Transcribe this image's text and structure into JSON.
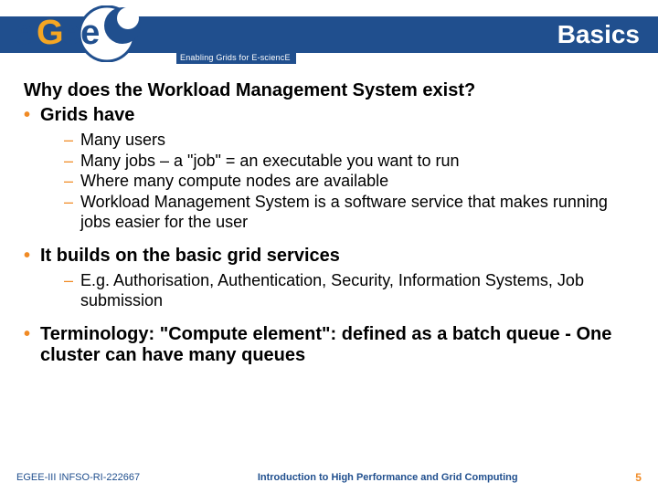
{
  "header": {
    "title": "Basics",
    "tagline": "Enabling Grids for E-sciencE",
    "logo_text_main": "eee",
    "logo_letter_g": "G"
  },
  "content": {
    "question": "Why does the Workload Management System exist?",
    "b1": "Grids have",
    "b1_sub": [
      "Many users",
      "Many jobs – a \"job\" = an executable you want to run",
      "Where many compute nodes are available",
      "Workload Management System is a software service that makes running jobs easier for the user"
    ],
    "b2": "It builds on the basic grid services",
    "b2_sub": [
      "E.g. Authorisation, Authentication, Security, Information Systems, Job submission"
    ],
    "b3": "Terminology: \"Compute element\": defined as  a batch queue - One cluster can have many queues"
  },
  "footer": {
    "left": "EGEE-III INFSO-RI-222667",
    "center": "Introduction to High Performance and Grid Computing",
    "page": "5"
  }
}
